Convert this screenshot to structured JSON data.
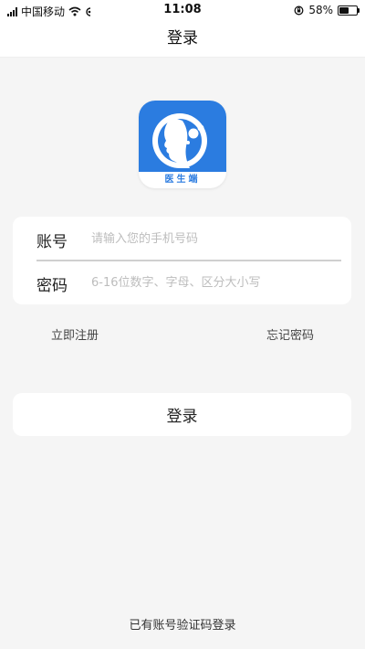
{
  "status_bar": {
    "carrier": "中国移动",
    "time": "11:08",
    "battery_percent": "58%",
    "battery_level": 0.58
  },
  "nav": {
    "title": "登录"
  },
  "logo": {
    "label": "医生端",
    "icon": "doctor-face-logo"
  },
  "form": {
    "account_label": "账号",
    "account_placeholder": "请输入您的手机号码",
    "password_label": "密码",
    "password_placeholder": "6-16位数字、字母、区分大小写"
  },
  "links": {
    "register": "立即注册",
    "forgot": "忘记密码"
  },
  "login_button": "登录",
  "sms_login": "已有账号验证码登录",
  "colors": {
    "brand": "#2b7ce0",
    "background": "#f5f5f5"
  }
}
